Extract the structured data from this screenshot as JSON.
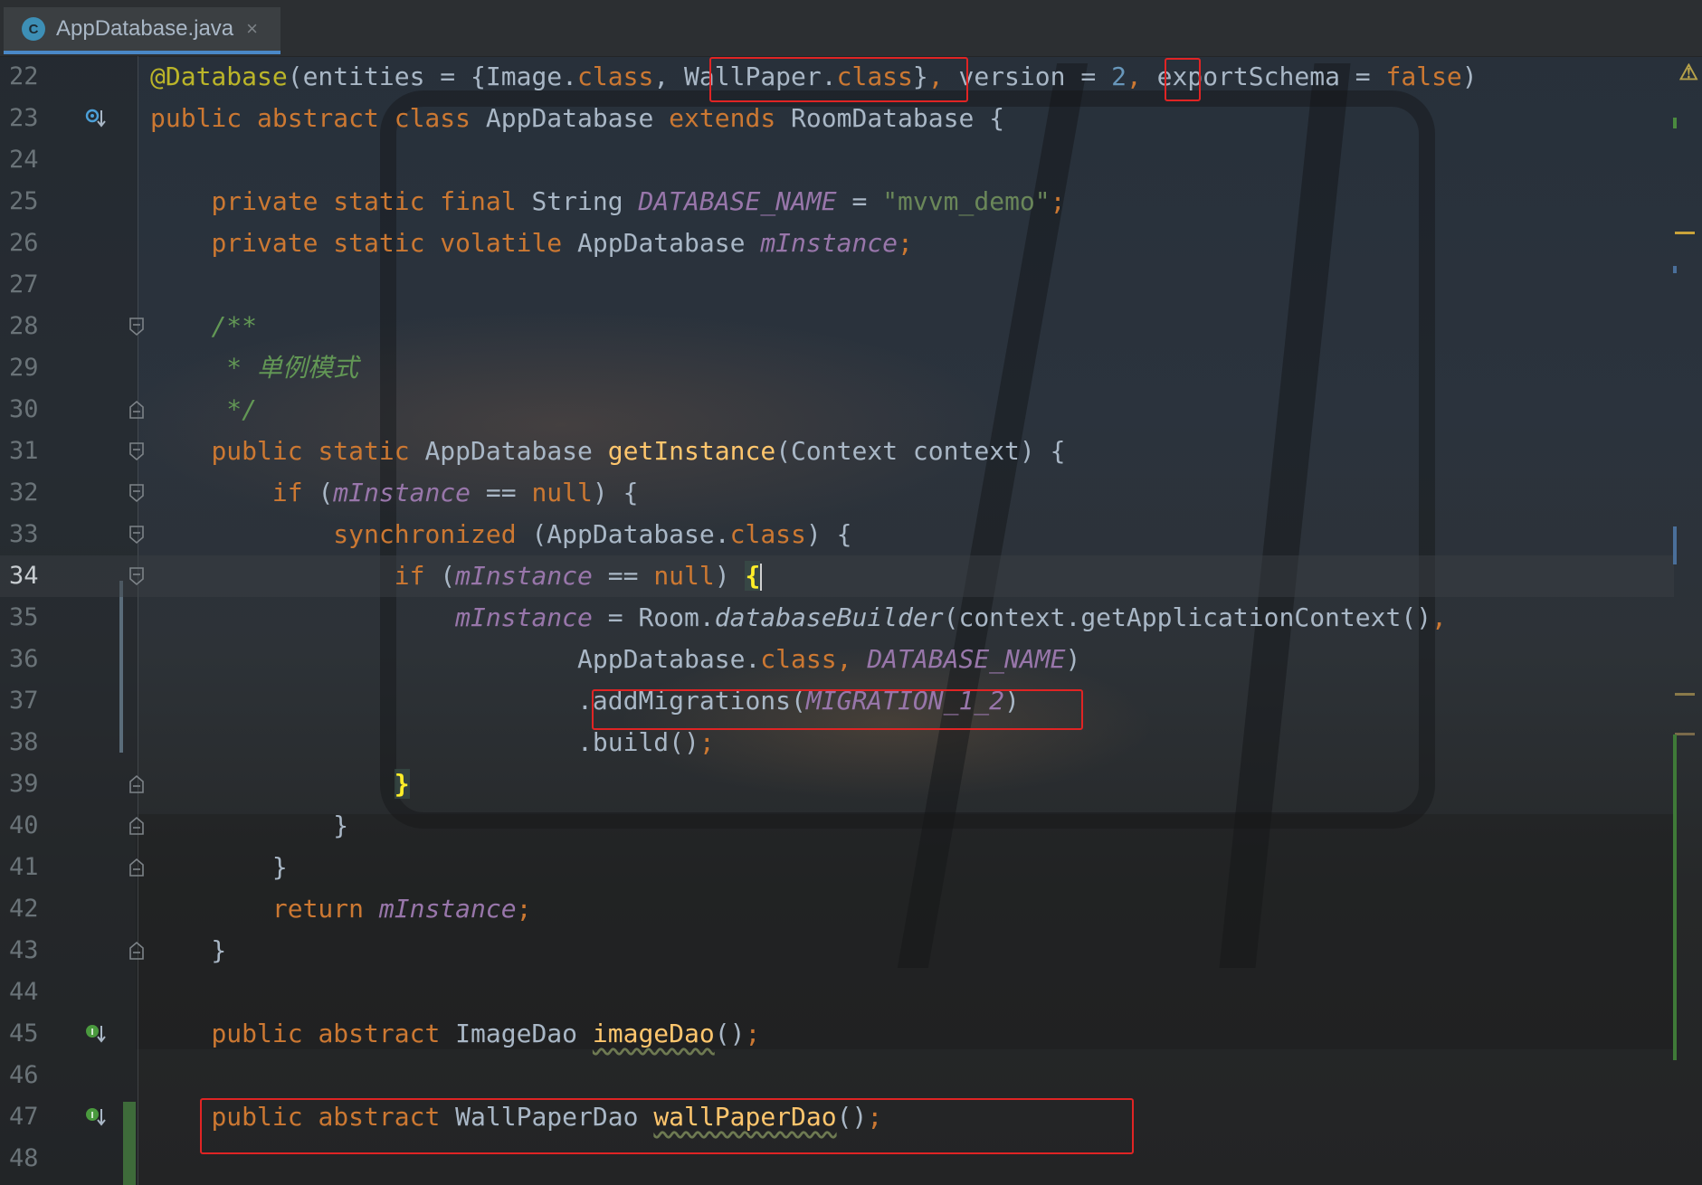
{
  "tab": {
    "icon_letter": "C",
    "filename": "AppDatabase.java",
    "close_glyph": "×"
  },
  "warning_glyph": "⚠",
  "lines": [
    {
      "n": "22",
      "code": [
        [
          "ann",
          "@Database"
        ],
        [
          "ident",
          "(entities = {Image."
        ],
        [
          "kw",
          "class"
        ],
        [
          "ident",
          ", "
        ],
        [
          "ident",
          "WallPaper."
        ],
        [
          "kw",
          "class"
        ],
        [
          "ident",
          "}"
        ],
        [
          "kw",
          ","
        ],
        [
          "ident",
          " version = "
        ],
        [
          "num",
          "2"
        ],
        [
          "kw",
          ","
        ],
        [
          "ident",
          " exportSchema = "
        ],
        [
          "kw",
          "false"
        ],
        [
          "ident",
          ")"
        ]
      ]
    },
    {
      "n": "23",
      "code": [
        [
          "kw",
          "public abstract class "
        ],
        [
          "cls",
          "AppDatabase "
        ],
        [
          "kw",
          "extends "
        ],
        [
          "cls",
          "RoomDatabase "
        ],
        [
          "ident",
          "{"
        ]
      ],
      "icon": "implemented-down"
    },
    {
      "n": "24",
      "code": []
    },
    {
      "n": "25",
      "code": [
        [
          "ident",
          "    "
        ],
        [
          "kw",
          "private static final "
        ],
        [
          "cls",
          "String "
        ],
        [
          "fld",
          "DATABASE_NAME"
        ],
        [
          "ident",
          " = "
        ],
        [
          "str",
          "\"mvvm_demo\""
        ],
        [
          "kw",
          ";"
        ]
      ]
    },
    {
      "n": "26",
      "code": [
        [
          "ident",
          "    "
        ],
        [
          "kw",
          "private static volatile "
        ],
        [
          "cls",
          "AppDatabase "
        ],
        [
          "fld",
          "mInstance"
        ],
        [
          "kw",
          ";"
        ]
      ]
    },
    {
      "n": "27",
      "code": []
    },
    {
      "n": "28",
      "code": [
        [
          "ident",
          "    "
        ],
        [
          "cmt",
          "/**"
        ]
      ],
      "fold": "open"
    },
    {
      "n": "29",
      "code": [
        [
          "ident",
          "     "
        ],
        [
          "cmt",
          "* 单例模式"
        ]
      ]
    },
    {
      "n": "30",
      "code": [
        [
          "ident",
          "     "
        ],
        [
          "cmt",
          "*/"
        ]
      ],
      "fold": "close"
    },
    {
      "n": "31",
      "code": [
        [
          "ident",
          "    "
        ],
        [
          "kw",
          "public static "
        ],
        [
          "cls",
          "AppDatabase "
        ],
        [
          "mth",
          "getInstance"
        ],
        [
          "ident",
          "(Context context) {"
        ]
      ],
      "fold": "open"
    },
    {
      "n": "32",
      "code": [
        [
          "ident",
          "        "
        ],
        [
          "kw",
          "if "
        ],
        [
          "ident",
          "("
        ],
        [
          "fld",
          "mInstance"
        ],
        [
          "ident",
          " == "
        ],
        [
          "kw",
          "null"
        ],
        [
          "ident",
          ") {"
        ]
      ],
      "fold": "open"
    },
    {
      "n": "33",
      "code": [
        [
          "ident",
          "            "
        ],
        [
          "kw",
          "synchronized "
        ],
        [
          "ident",
          "(AppDatabase."
        ],
        [
          "kw",
          "class"
        ],
        [
          "ident",
          ") {"
        ]
      ],
      "fold": "open"
    },
    {
      "n": "34",
      "code": [
        [
          "ident",
          "                "
        ],
        [
          "kw",
          "if "
        ],
        [
          "ident",
          "("
        ],
        [
          "fld",
          "mInstance"
        ],
        [
          "ident",
          " == "
        ],
        [
          "kw",
          "null"
        ],
        [
          "ident",
          ") "
        ],
        [
          "brace",
          "{"
        ]
      ],
      "fold": "open",
      "current": true
    },
    {
      "n": "35",
      "code": [
        [
          "ident",
          "                    "
        ],
        [
          "fld",
          "mInstance"
        ],
        [
          "ident",
          " = Room."
        ],
        [
          "smth",
          "databaseBuilder"
        ],
        [
          "ident",
          "(context.getApplicationContext()"
        ],
        [
          "kw",
          ","
        ]
      ]
    },
    {
      "n": "36",
      "code": [
        [
          "ident",
          "                            AppDatabase."
        ],
        [
          "kw",
          "class"
        ],
        [
          "kw",
          ", "
        ],
        [
          "fld",
          "DATABASE_NAME"
        ],
        [
          "ident",
          ")"
        ]
      ]
    },
    {
      "n": "37",
      "code": [
        [
          "ident",
          "                            .addMigrations("
        ],
        [
          "fld",
          "MIGRATION_1_2"
        ],
        [
          "ident",
          ")"
        ]
      ]
    },
    {
      "n": "38",
      "code": [
        [
          "ident",
          "                            .build()"
        ],
        [
          "kw",
          ";"
        ]
      ]
    },
    {
      "n": "39",
      "code": [
        [
          "ident",
          "                "
        ],
        [
          "bracehl",
          "}"
        ]
      ],
      "fold": "close"
    },
    {
      "n": "40",
      "code": [
        [
          "ident",
          "            }"
        ]
      ],
      "fold": "close"
    },
    {
      "n": "41",
      "code": [
        [
          "ident",
          "        }"
        ]
      ],
      "fold": "close"
    },
    {
      "n": "42",
      "code": [
        [
          "ident",
          "        "
        ],
        [
          "kw",
          "return "
        ],
        [
          "fld",
          "mInstance"
        ],
        [
          "kw",
          ";"
        ]
      ]
    },
    {
      "n": "43",
      "code": [
        [
          "ident",
          "    }"
        ]
      ],
      "fold": "close"
    },
    {
      "n": "44",
      "code": []
    },
    {
      "n": "45",
      "code": [
        [
          "ident",
          "    "
        ],
        [
          "kw",
          "public abstract "
        ],
        [
          "cls",
          "ImageDao "
        ],
        [
          "squig",
          "imageDao"
        ],
        [
          "ident",
          "()"
        ],
        [
          "kw",
          ";"
        ]
      ],
      "icon": "implemented-green"
    },
    {
      "n": "46",
      "code": []
    },
    {
      "n": "47",
      "code": [
        [
          "ident",
          "    "
        ],
        [
          "kw",
          "public abstract "
        ],
        [
          "cls",
          "WallPaperDao "
        ],
        [
          "squig",
          "wallPaperDao"
        ],
        [
          "ident",
          "()"
        ],
        [
          "kw",
          ";"
        ]
      ],
      "icon": "implemented-green"
    },
    {
      "n": "48",
      "code": []
    }
  ]
}
